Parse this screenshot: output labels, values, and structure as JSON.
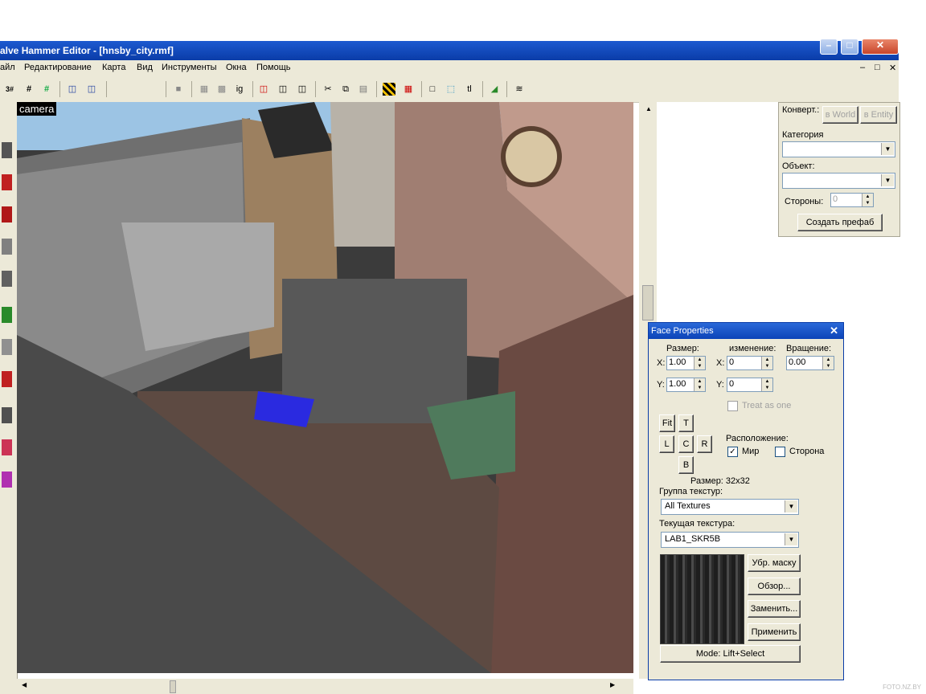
{
  "window": {
    "title": "alve Hammer Editor - [hnsby_city.rmf]",
    "controls": {
      "minimize": "–",
      "maximize": "□",
      "close": "✕"
    }
  },
  "menu": {
    "items": [
      "айл",
      "Редактирование",
      "Карта",
      "Вид",
      "Инструменты",
      "Окна",
      "Помощь"
    ],
    "mdi_controls": [
      "–",
      "□",
      "✕"
    ]
  },
  "toolbar": {
    "icons": [
      "3d-grid-icon",
      "grid-icon",
      "grid-add-icon",
      "copy-view-icon",
      "paste-view-icon",
      "hide-icon",
      "group-icon",
      "ungroup-icon",
      "ignore-groups-icon",
      "carve-icon",
      "hollow-icon",
      "texture-lock-icon",
      "cut-icon",
      "copy-icon",
      "paste-icon",
      "toggle-texture-icon",
      "selection-icon",
      "vertex-icon",
      "clip-icon",
      "text-icon",
      "flip-icon",
      "run-map-icon"
    ],
    "labels": {
      "ignore_groups": "ig",
      "text_tool": "tl"
    }
  },
  "viewport": {
    "label": "camera"
  },
  "object_panel": {
    "convert_label": "Конверт.:",
    "to_world": "в World",
    "to_entity": "в Entity",
    "category_label": "Категория",
    "object_label": "Объект:",
    "faces_label": "Стороны:",
    "faces_value": "0",
    "create_prefab": "Создать префаб"
  },
  "face_properties": {
    "title": "Face Properties",
    "close": "✕",
    "scale_label": "Размер:",
    "shift_label": "изменение:",
    "rotation_label": "Вращение:",
    "x_label": "X:",
    "y_label": "Y:",
    "scale_x": "1.00",
    "scale_y": "1.00",
    "shift_x": "0",
    "shift_y": "0",
    "rotation": "0.00",
    "treat_as_one": "Treat as one",
    "buttons": {
      "fit": "Fit",
      "top": "T",
      "left": "L",
      "center": "C",
      "right": "R",
      "bottom": "B"
    },
    "alignment_label": "Расположение:",
    "world_label": "Мир",
    "world_checked": true,
    "face_label": "Сторона",
    "face_checked": false,
    "size_label": "Размер: 32x32",
    "texture_group_label": "Группа текстур:",
    "texture_group": "All Textures",
    "current_texture_label": "Текущая текстура:",
    "current_texture": "LAB1_SKR5B",
    "hide_mask": "Убр. маску",
    "browse": "Обзор...",
    "replace": "Заменить...",
    "apply": "Применить",
    "mode": "Mode: Lift+Select"
  },
  "watermark": "FOTO.NZ.BY"
}
